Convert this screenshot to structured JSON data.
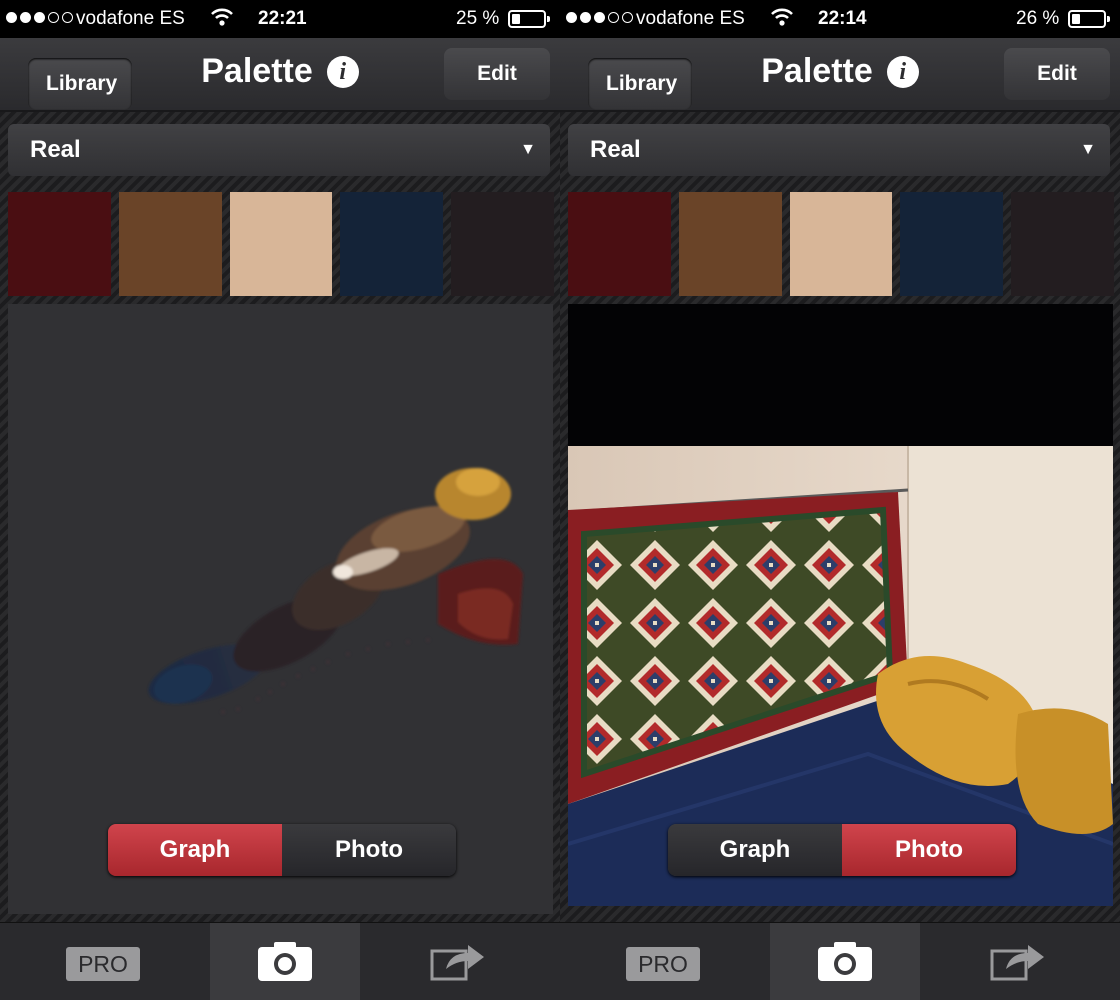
{
  "left": {
    "status": {
      "carrier": "vodafone ES",
      "time": "22:21",
      "battery_pct": "25 %",
      "battery_level": 0.25
    },
    "nav": {
      "back_label": "Library",
      "title": "Palette",
      "info_glyph": "i",
      "edit_label": "Edit"
    },
    "dropdown": {
      "value": "Real",
      "caret": "▼"
    },
    "swatches": [
      "#4a0e12",
      "#6a4428",
      "#d8b698",
      "#142338",
      "#231d20"
    ],
    "segments": {
      "graph": "Graph",
      "photo": "Photo",
      "selected": "graph"
    },
    "tabbar": {
      "pro_label": "PRO",
      "camera_icon": "camera-icon",
      "share_icon": "share-icon"
    }
  },
  "right": {
    "status": {
      "carrier": "vodafone ES",
      "time": "22:14",
      "battery_pct": "26 %",
      "battery_level": 0.26
    },
    "nav": {
      "back_label": "Library",
      "title": "Palette",
      "info_glyph": "i",
      "edit_label": "Edit"
    },
    "dropdown": {
      "value": "Real",
      "caret": "▼"
    },
    "swatches": [
      "#4a0e12",
      "#6a4428",
      "#d8b698",
      "#142338",
      "#231d20"
    ],
    "segments": {
      "graph": "Graph",
      "photo": "Photo",
      "selected": "photo"
    },
    "tabbar": {
      "pro_label": "PRO",
      "camera_icon": "camera-icon",
      "share_icon": "share-icon"
    }
  },
  "colors": {
    "accent_red": "#c0353c",
    "nav_bg": "#343437",
    "status_bg": "#000000"
  }
}
